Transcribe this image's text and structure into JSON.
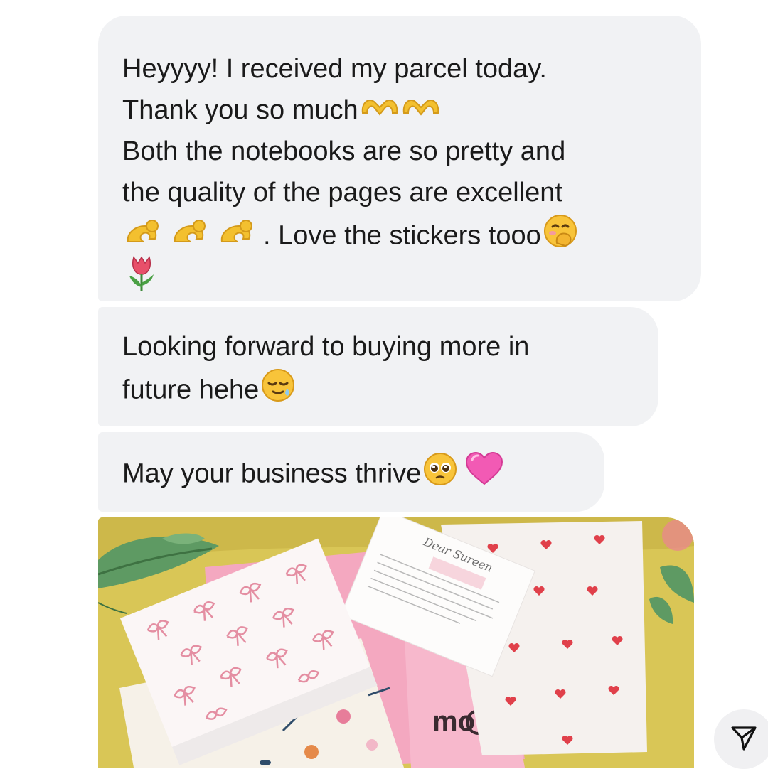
{
  "messages": [
    {
      "lines": [
        "Heyyyy! I received my parcel today.",
        "Thank you so much",
        "Both the notebooks are so pretty and",
        "the quality of the pages are excellent",
        ". Love the stickers tooo",
        ""
      ],
      "emojis": [
        "heart-hands-icon",
        "heart-hands-icon",
        "pinched-fingers-icon",
        "pinched-fingers-icon",
        "pinched-fingers-icon",
        "face-with-hand-over-mouth-icon",
        "tulip-icon"
      ]
    },
    {
      "lines": [
        "Looking forward to buying more in",
        "future hehe"
      ],
      "emojis": [
        "relieved-face-icon"
      ]
    },
    {
      "lines": [
        "May your business thrive"
      ],
      "emojis": [
        "pleading-face-icon",
        "pink-heart-icon"
      ]
    }
  ],
  "photo": {
    "card_heading": "Dear Sureen",
    "bag_text": "mo"
  },
  "colors": {
    "bubble_bg": "#f1f2f4",
    "text": "#1a1a1a",
    "heart_red": "#e0404a",
    "pink": "#f26fb0"
  }
}
